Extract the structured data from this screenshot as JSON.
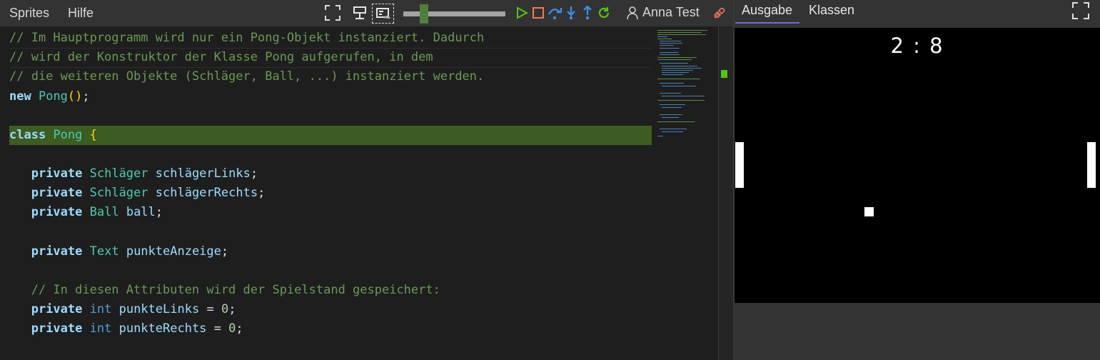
{
  "menu": {
    "sprites": "Sprites",
    "hilfe": "Hilfe"
  },
  "user": {
    "name": "Anna Test"
  },
  "toolbar": {
    "slider_level": 0.2,
    "icons": [
      "fullscreen-icon",
      "presentation-icon",
      "console-icon",
      "play-icon",
      "stop-icon",
      "step-over-icon",
      "step-into-icon",
      "step-out-icon",
      "restart-icon",
      "user-icon",
      "disconnect-icon"
    ]
  },
  "editor": {
    "lines": [
      "// Im Hauptprogramm wird nur ein Pong-Objekt instanziert. Dadurch",
      "// wird der Konstruktor der Klasse Pong aufgerufen, in dem",
      "// die weiteren Objekte (Schläger, Ball, ...) instanziert werden.",
      "new Pong();",
      "",
      "class Pong {",
      "",
      "   private Schläger schlägerLinks;",
      "   private Schläger schlägerRechts;",
      "   private Ball ball;",
      "",
      "   private Text punkteAnzeige;",
      "",
      "   // In diesen Attributen wird der Spielstand gespeichert:",
      "   private int punkteLinks = 0;",
      "   private int punkteRechts = 0;"
    ],
    "highlighted_line": 6
  },
  "right_panel": {
    "tabs": [
      "Ausgabe",
      "Klassen"
    ],
    "active_tab": "Ausgabe",
    "game": {
      "score": "2 : 8"
    }
  },
  "colors": {
    "highlight": "#3d5c22",
    "comment": "#6a9955",
    "keyword": "#569cd6",
    "type": "#4ec9b0",
    "accent_green": "#55c414"
  }
}
